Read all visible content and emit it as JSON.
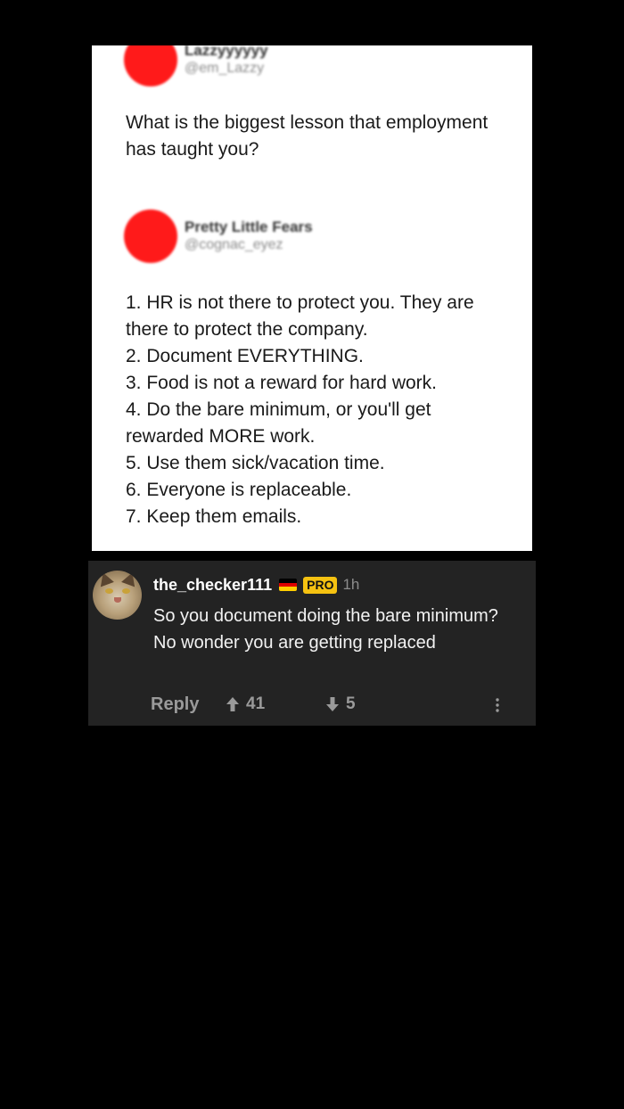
{
  "tweet": {
    "author1": {
      "name": "Lazzyyyyyy",
      "handle": "@em_Lazzy"
    },
    "question": "What is the biggest lesson that employment has taught you?",
    "author2": {
      "name": "Pretty Little Fears",
      "handle": "@cognac_eyez"
    },
    "answer_lines": [
      "1. HR is not there to protect you. They are there to protect the company.",
      "2. Document EVERYTHING.",
      "3. Food is not a reward for hard work.",
      "4. Do the bare minimum, or you'll get rewarded MORE work.",
      "5. Use them sick/vacation time.",
      "6. Everyone is replaceable.",
      "7. Keep them emails."
    ],
    "redaction_color": "#ff1a1a"
  },
  "comment": {
    "username": "the_checker111",
    "flag_icon": "germany-flag-icon",
    "badge": "PRO",
    "time": "1h",
    "text": "So you document doing the bare minimum? No wonder you are getting replaced",
    "reply_label": "Reply",
    "upvotes": "41",
    "downvotes": "5",
    "avatar": "cat-avatar"
  },
  "colors": {
    "background": "#000000",
    "comment_bg": "#232323",
    "badge_bg": "#f5c211",
    "action_text": "#9a9a9a"
  }
}
